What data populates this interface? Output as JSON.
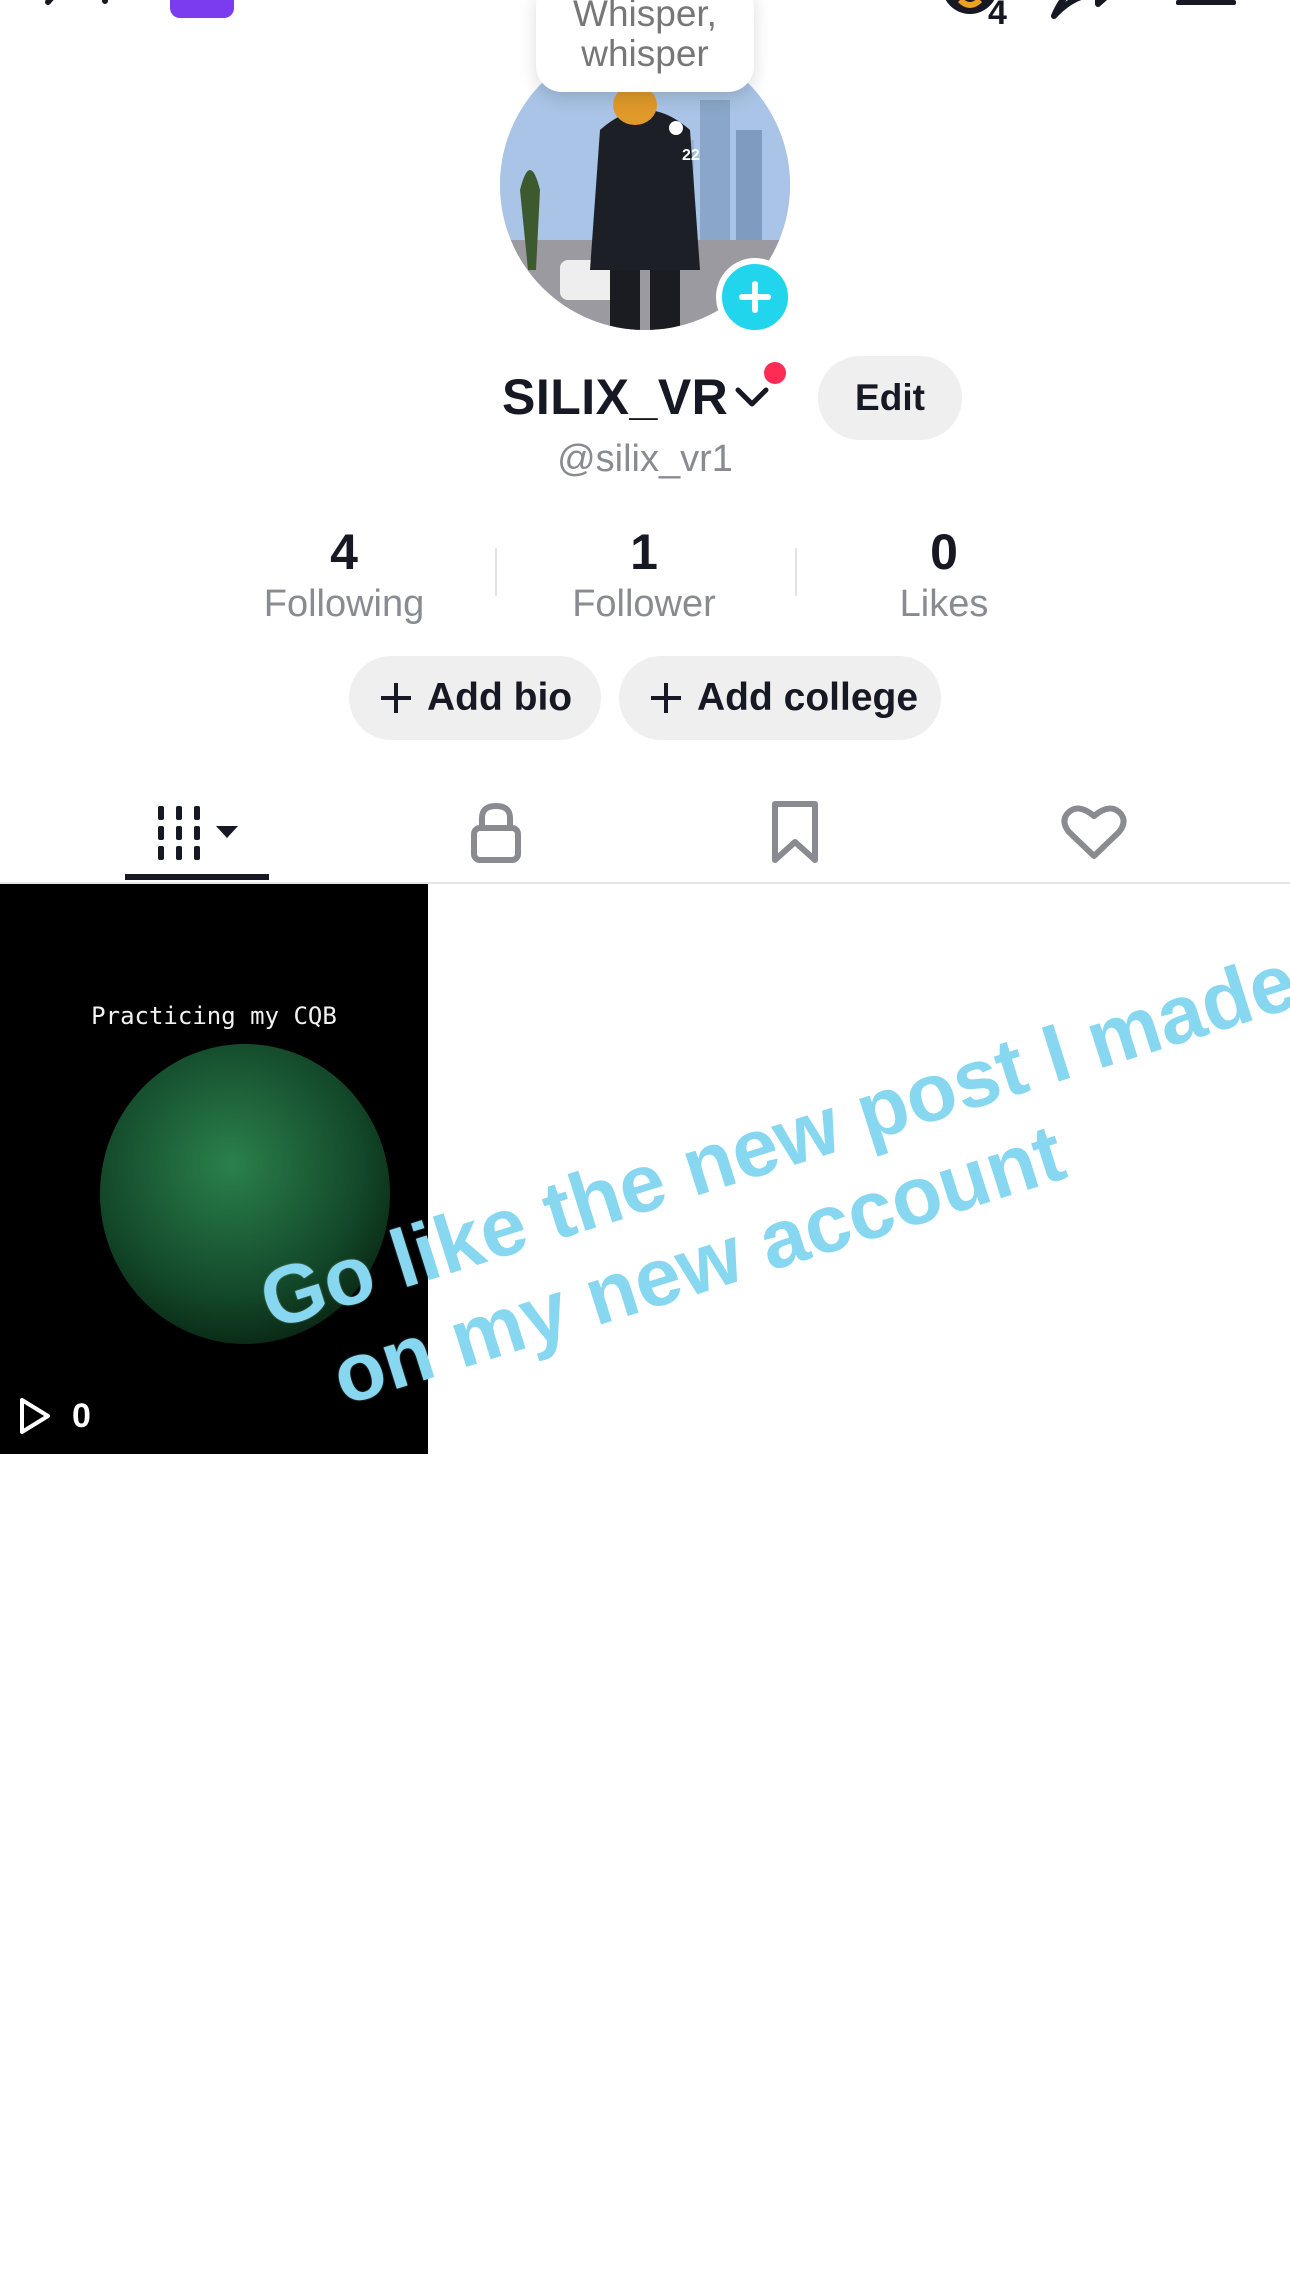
{
  "topbar": {
    "add_friend_icon": "person-add-icon",
    "creator_badge_count": "4",
    "share_icon": "share-arrow-icon",
    "menu_icon": "hamburger-menu-icon"
  },
  "profile": {
    "bubble_text_line1": "Whisper,",
    "bubble_text_line2": "whisper",
    "display_name": "SILIX_VR",
    "handle": "@silix_vr1",
    "edit_label": "Edit",
    "stats": {
      "following_count": "4",
      "following_label": "Following",
      "followers_count": "1",
      "followers_label": "Follower",
      "likes_count": "0",
      "likes_label": "Likes"
    },
    "add_bio_label": "Add bio",
    "add_college_label": "Add college"
  },
  "tabs": [
    {
      "name": "videos",
      "icon": "grid-videos-icon",
      "active": true
    },
    {
      "name": "private",
      "icon": "lock-icon",
      "active": false
    },
    {
      "name": "saved",
      "icon": "bookmark-icon",
      "active": false
    },
    {
      "name": "liked",
      "icon": "heart-icon",
      "active": false
    }
  ],
  "videos": [
    {
      "caption": "Practicing my CQB",
      "views": "0"
    }
  ],
  "overlay_text": {
    "line1": "Go like the new post I made",
    "line2": "on my new account"
  },
  "colors": {
    "accent_cyan": "#20d5ec",
    "notification_red": "#fe2c55",
    "overlay_text": "#86d7ef"
  }
}
